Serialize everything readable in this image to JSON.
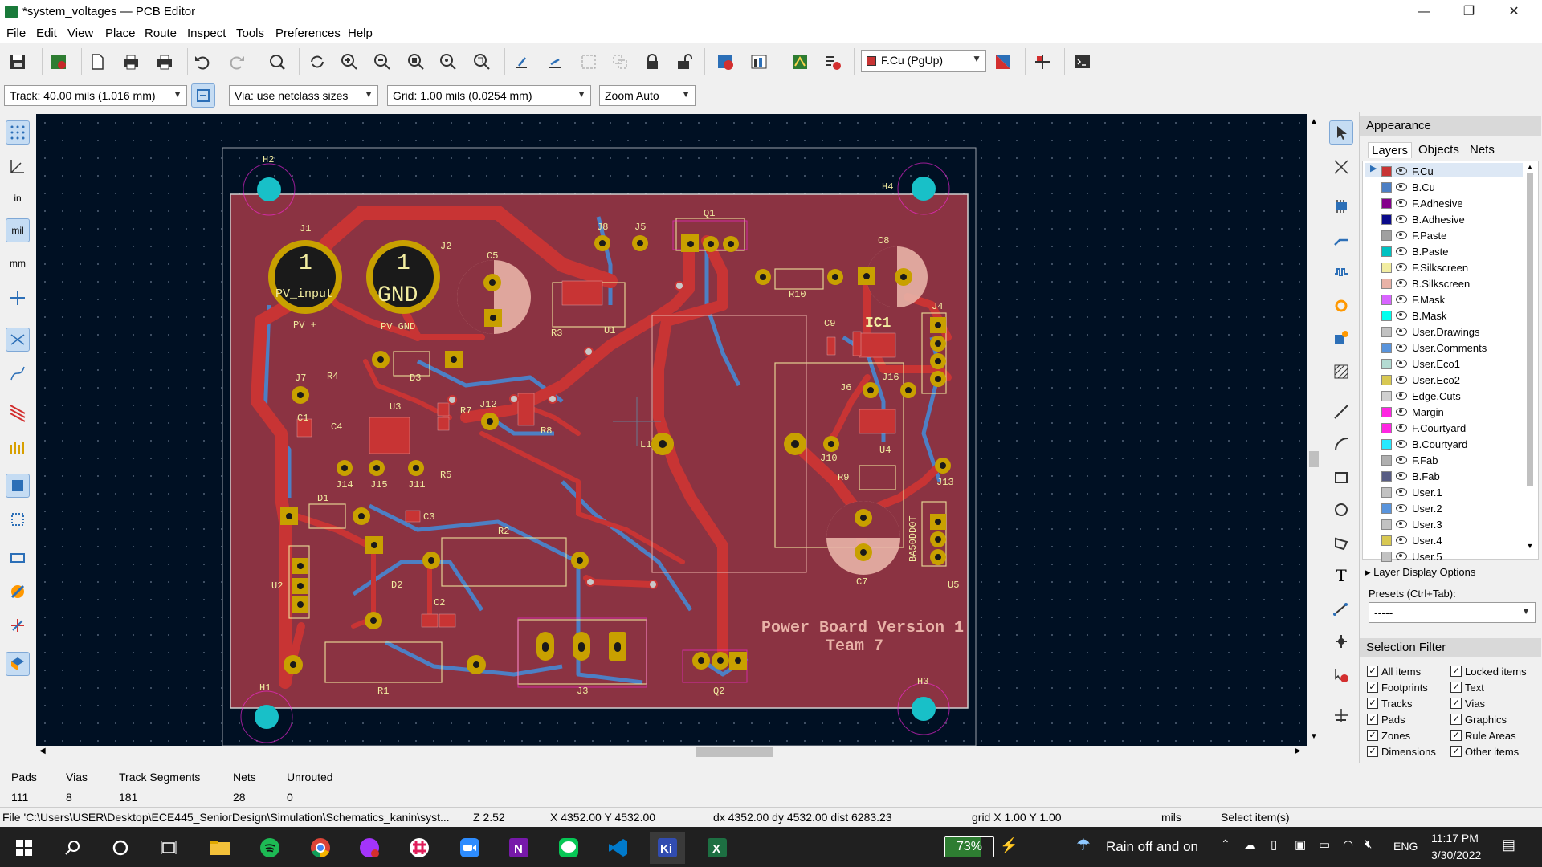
{
  "window": {
    "title": "*system_voltages — PCB Editor",
    "minimize": "—",
    "maximize": "❐",
    "close": "✕"
  },
  "menu": [
    "File",
    "Edit",
    "View",
    "Place",
    "Route",
    "Inspect",
    "Tools",
    "Preferences",
    "Help"
  ],
  "toolbar": {
    "layer_select": "F.Cu (PgUp)",
    "layer_color": "#c83434"
  },
  "toolbar2": {
    "track": "Track: 40.00 mils (1.016 mm)",
    "via": "Via: use netclass sizes",
    "grid": "Grid: 1.00 mils (0.0254 mm)",
    "zoom": "Zoom Auto"
  },
  "board": {
    "labels": {
      "h1": "H1",
      "h2": "H2",
      "h3": "H3",
      "h4": "H4",
      "j1": "J1",
      "j2": "J2",
      "j3": "J3",
      "j4": "J4",
      "j5": "J5",
      "j6": "J6",
      "j7": "J7",
      "j8": "J8",
      "j10": "J10",
      "j11": "J11",
      "j12": "J12",
      "j13": "J13",
      "j14": "J14",
      "j15": "J15",
      "j16": "J16",
      "c1": "C1",
      "c2": "C2",
      "c3": "C3",
      "c4": "C4",
      "c5": "C5",
      "c7": "C7",
      "c8": "C8",
      "c9": "C9",
      "r1": "R1",
      "r2": "R2",
      "r3": "R3",
      "r4": "R4",
      "r5": "R5",
      "r7": "R7",
      "r8": "R8",
      "r9": "R9",
      "r10": "R10",
      "u1": "U1",
      "u2": "U2",
      "u3": "U3",
      "u4": "U4",
      "u5": "U5",
      "q1": "Q1",
      "q2": "Q2",
      "d1": "D1",
      "d2": "D2",
      "d3": "D3",
      "l1": "L1",
      "ic1": "IC1",
      "pv_plus": "PV +",
      "pv_gnd": "PV GND",
      "pv_input": "PV_input",
      "gnd": "GND",
      "one_a": "1",
      "one_b": "1",
      "ba50": "BA50DD0T",
      "title1": "Power Board Version 1",
      "title2": "Team 7"
    },
    "colors": {
      "background": "#001023",
      "board": "#8b3342",
      "copper": "#c83434",
      "back_copper": "#4d7fc4",
      "pad": "#c8a000",
      "hole": "#18c0c8",
      "silk": "#f2eda1",
      "courtyard": "#ff26e2"
    }
  },
  "appearance": {
    "title": "Appearance",
    "tabs": [
      "Layers",
      "Objects",
      "Nets"
    ],
    "layers": [
      {
        "name": "F.Cu",
        "color": "#c83434"
      },
      {
        "name": "B.Cu",
        "color": "#4d7fc4"
      },
      {
        "name": "F.Adhesive",
        "color": "#84008a"
      },
      {
        "name": "B.Adhesive",
        "color": "#0a0a8a"
      },
      {
        "name": "F.Paste",
        "color": "#a0a0a0"
      },
      {
        "name": "B.Paste",
        "color": "#00c2c2"
      },
      {
        "name": "F.Silkscreen",
        "color": "#f2eda1"
      },
      {
        "name": "B.Silkscreen",
        "color": "#e8b2a7"
      },
      {
        "name": "F.Mask",
        "color": "#d864ff"
      },
      {
        "name": "B.Mask",
        "color": "#02ffee"
      },
      {
        "name": "User.Drawings",
        "color": "#c2c2c2"
      },
      {
        "name": "User.Comments",
        "color": "#5994dc"
      },
      {
        "name": "User.Eco1",
        "color": "#b4dbd2"
      },
      {
        "name": "User.Eco2",
        "color": "#d8c852"
      },
      {
        "name": "Edge.Cuts",
        "color": "#d0d0d0"
      },
      {
        "name": "Margin",
        "color": "#ff26e2"
      },
      {
        "name": "F.Courtyard",
        "color": "#ff26e2"
      },
      {
        "name": "B.Courtyard",
        "color": "#26e9ff"
      },
      {
        "name": "F.Fab",
        "color": "#afafaf"
      },
      {
        "name": "B.Fab",
        "color": "#585d84"
      },
      {
        "name": "User.1",
        "color": "#c2c2c2"
      },
      {
        "name": "User.2",
        "color": "#5994dc"
      },
      {
        "name": "User.3",
        "color": "#c2c2c2"
      },
      {
        "name": "User.4",
        "color": "#d8c852"
      },
      {
        "name": "User.5",
        "color": "#c2c2c2"
      }
    ],
    "layer_display_options": "Layer Display Options",
    "presets_label": "Presets (Ctrl+Tab):",
    "presets_value": "-----",
    "selection_filter": "Selection Filter",
    "filters_left": [
      "All items",
      "Footprints",
      "Tracks",
      "Pads",
      "Zones",
      "Dimensions"
    ],
    "filters_right": [
      "Locked items",
      "Text",
      "Vias",
      "Graphics",
      "Rule Areas",
      "Other items"
    ]
  },
  "stats": {
    "headers": [
      "Pads",
      "Vias",
      "Track Segments",
      "Nets",
      "Unrouted"
    ],
    "values": [
      "111",
      "8",
      "181",
      "28",
      "0"
    ]
  },
  "statusline": {
    "file": "File 'C:\\Users\\USER\\Desktop\\ECE445_SeniorDesign\\Simulation\\Schematics_kanin\\syst...",
    "zoom": "Z 2.52",
    "xy": "X 4352.00  Y 4532.00",
    "delta": "dx 4352.00  dy 4532.00  dist 6283.23",
    "grid": "grid X 1.00  Y 1.00",
    "units": "mils",
    "mode": "Select item(s)"
  },
  "taskbar": {
    "battery": "73%",
    "weather": "Rain off and on",
    "lang": "ENG",
    "time": "11:17 PM",
    "date": "3/30/2022"
  }
}
